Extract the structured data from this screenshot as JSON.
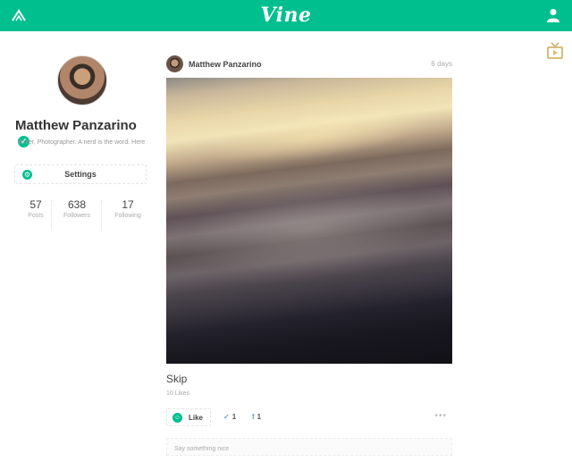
{
  "header": {
    "logo": "Vine",
    "home_icon": "home-icon",
    "user_icon": "user-icon",
    "tv_icon": "tv-icon",
    "brand_color": "#00bf8f"
  },
  "profile": {
    "name": "Matthew Panzarino",
    "bio": "Writer, Photographer. A nerd is the word. Here",
    "settings_label": "Settings",
    "stats": [
      {
        "value": "57",
        "label": "Posts"
      },
      {
        "value": "638",
        "label": "Followers"
      },
      {
        "value": "17",
        "label": "Following"
      }
    ]
  },
  "post": {
    "author": "Matthew Panzarino",
    "age": "6 days",
    "title": "Skip",
    "likes": "10 Likes",
    "like_label": "Like",
    "twitter_count": "1",
    "facebook_count": "1",
    "more": "•••",
    "comment_placeholder": "Say something nice"
  }
}
